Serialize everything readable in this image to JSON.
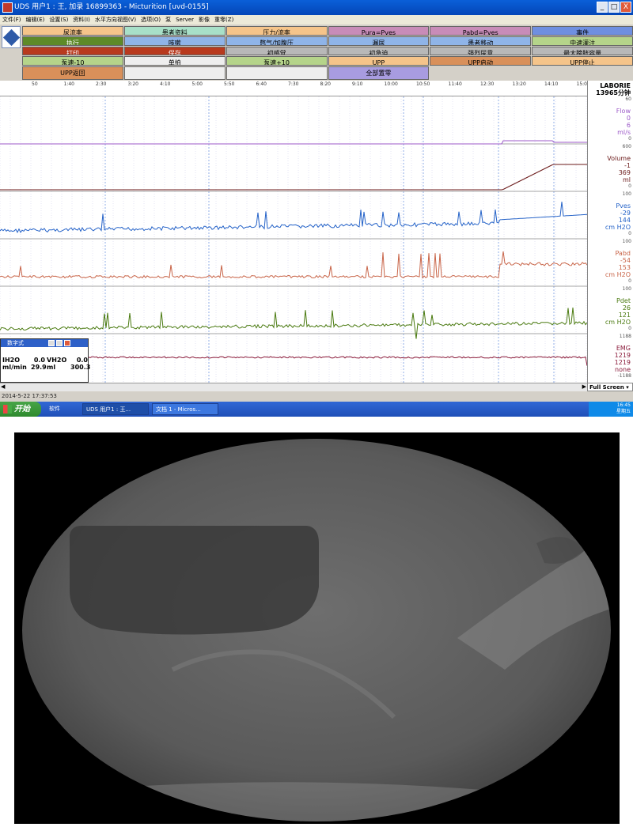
{
  "window": {
    "title": "UDS 用户1 : 王, 加录  16899363 - Micturition [uvd-0155]",
    "min_label": "_",
    "max_label": "□",
    "close_label": "X"
  },
  "menu": [
    "文件(F)",
    "编辑(E)",
    "设置(S)",
    "资料(I)",
    "水平方向视图(V)",
    "选项(O)",
    "泵",
    "Server",
    "影像",
    "重零(Z)"
  ],
  "buttons": [
    {
      "label": "尿流率",
      "color": "#f5c48a"
    },
    {
      "label": "患者资料",
      "color": "#a8e0c8"
    },
    {
      "label": "压力/流率",
      "color": "#f5c48a"
    },
    {
      "label": "Pura=Pves",
      "color": "#c88cb8"
    },
    {
      "label": "Pabd=Pves",
      "color": "#c88cb8"
    },
    {
      "label": "事件",
      "color": "#6f8fe0"
    },
    {
      "label": "执行",
      "color": "#5e8a28"
    },
    {
      "label": "咳嗽",
      "color": "#8fb4e8"
    },
    {
      "label": "憋气/加腹压",
      "color": "#8fb4e8"
    },
    {
      "label": "漏尿",
      "color": "#8fb4e8"
    },
    {
      "label": "患者移动",
      "color": "#8fb4e8"
    },
    {
      "label": "中速灌注",
      "color": "#b5d48a"
    },
    {
      "label": "打印",
      "color": "#b83a1e"
    },
    {
      "label": "保存",
      "color": "#b83a1e"
    },
    {
      "label": "初感觉",
      "color": "#b8b8b8"
    },
    {
      "label": "初急迫",
      "color": "#b8b8b8"
    },
    {
      "label": "强烈尿意",
      "color": "#b8b8b8"
    },
    {
      "label": "最大膀胱容量",
      "color": "#b8b8b8"
    },
    {
      "label": "泵速-10",
      "color": "#b5d48a"
    },
    {
      "label": "单拍",
      "color": "#eeeeee"
    },
    {
      "label": "泵速+10",
      "color": "#b5d48a"
    },
    {
      "label": "UPP",
      "color": "#f5c48a"
    },
    {
      "label": "UPP启动",
      "color": "#d9905a"
    },
    {
      "label": "UPP停止",
      "color": "#f5c48a"
    },
    {
      "label": "UPP返回",
      "color": "#d9905a"
    },
    {
      "label": "",
      "color": "#eeeeee"
    },
    {
      "label": "",
      "color": "#eeeeee"
    },
    {
      "label": "全部置零",
      "color": "#a89ce0"
    }
  ],
  "ruler_ticks": [
    "50",
    "1:40",
    "2:30",
    "3:20",
    "4:10",
    "5:00",
    "5:50",
    "6:40",
    "7:30",
    "8:20",
    "9:10",
    "10:00",
    "10:50",
    "11:40",
    "12:30",
    "13:20",
    "14:10",
    "15:00"
  ],
  "header": {
    "brand": "LABORIE",
    "duration": "13965分钟"
  },
  "channels": [
    {
      "name": "Flow",
      "v1": "0",
      "v2": "6",
      "unit": "ml/s",
      "color": "#9c5ac8",
      "max": "60",
      "min": "0"
    },
    {
      "name": "Volume",
      "v1": "-1",
      "v2": "369",
      "unit": "ml",
      "color": "#6b1a1a",
      "max": "600",
      "min": "0"
    },
    {
      "name": "Pves",
      "v1": "-29",
      "v2": "144",
      "unit": "cm H2O",
      "color": "#2462c8",
      "max": "100",
      "min": "0"
    },
    {
      "name": "Pabd",
      "v1": "-54",
      "v2": "153",
      "unit": "cm H2O",
      "color": "#c86448",
      "max": "100",
      "min": "0"
    },
    {
      "name": "Pdet",
      "v1": "26",
      "v2": "121",
      "unit": "cm H2O",
      "color": "#4a7a10",
      "max": "100",
      "min": "0"
    },
    {
      "name": "EMG",
      "v1": "1219",
      "v2": "1219",
      "unit": "none",
      "color": "#8a1a3a",
      "max": "1188",
      "min": "-1188"
    }
  ],
  "float_panel": {
    "title": "数字式",
    "c1a": "IH2O",
    "c1b": "ml/min",
    "c2a": "0.0",
    "c2b": "29.9",
    "c3a": "VH2O",
    "c3b": "ml",
    "c4a": "0.0",
    "c4b": "300.3"
  },
  "full_screen": "Full Screen",
  "datetime": "2014-5-22 17:37:53",
  "taskbar": {
    "start": "开始",
    "tasks": [
      "软件",
      "UDS 用户1 : 王...",
      "文档 1 - Micros..."
    ],
    "time": "16:45",
    "day": "星期五"
  }
}
